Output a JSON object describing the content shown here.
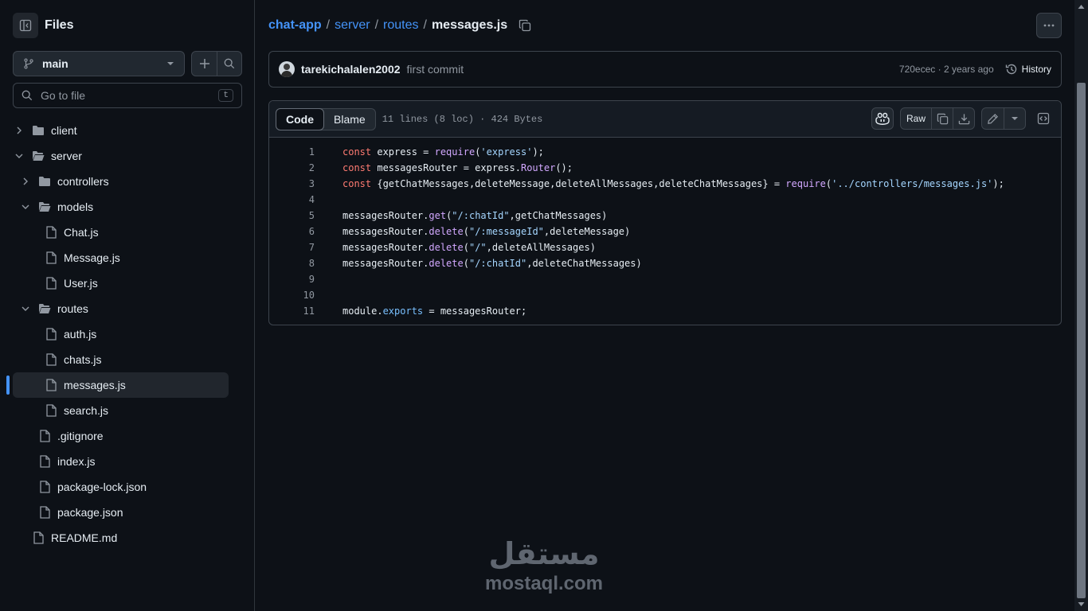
{
  "sidebar": {
    "title": "Files",
    "branch": "main",
    "goto_placeholder": "Go to file",
    "goto_shortcut": "t",
    "tree": [
      {
        "label": "client",
        "type": "folder",
        "state": "collapsed"
      },
      {
        "label": "server",
        "type": "folder",
        "state": "expanded"
      },
      {
        "label": "controllers",
        "type": "folder",
        "state": "collapsed"
      },
      {
        "label": "models",
        "type": "folder",
        "state": "expanded"
      },
      {
        "label": "Chat.js",
        "type": "file"
      },
      {
        "label": "Message.js",
        "type": "file"
      },
      {
        "label": "User.js",
        "type": "file"
      },
      {
        "label": "routes",
        "type": "folder",
        "state": "expanded"
      },
      {
        "label": "auth.js",
        "type": "file"
      },
      {
        "label": "chats.js",
        "type": "file"
      },
      {
        "label": "messages.js",
        "type": "file",
        "selected": true
      },
      {
        "label": "search.js",
        "type": "file"
      },
      {
        "label": ".gitignore",
        "type": "file"
      },
      {
        "label": "index.js",
        "type": "file"
      },
      {
        "label": "package-lock.json",
        "type": "file"
      },
      {
        "label": "package.json",
        "type": "file"
      },
      {
        "label": "README.md",
        "type": "file"
      }
    ]
  },
  "breadcrumb": {
    "parts": [
      "chat-app",
      "server",
      "routes"
    ],
    "separator": "/",
    "current": "messages.js"
  },
  "commit": {
    "author": "tarekichalalen2002",
    "message": "first commit",
    "meta": "720ecec · 2 years ago",
    "history_label": "History"
  },
  "code": {
    "tabs": [
      "Code",
      "Blame"
    ],
    "active_tab": "Code",
    "info": "11 lines (8 loc) · 424 Bytes",
    "raw_label": "Raw",
    "lines": [
      "const express = require('express');",
      "const messagesRouter = express.Router();",
      "const {getChatMessages,deleteMessage,deleteAllMessages,deleteChatMessages} = require('../controllers/messages.js');",
      "",
      "messagesRouter.get(\"/:chatId\",getChatMessages)",
      "messagesRouter.delete(\"/:messageId\",deleteMessage)",
      "messagesRouter.delete(\"/\",deleteAllMessages)",
      "messagesRouter.delete(\"/:chatId\",deleteChatMessages)",
      "",
      "",
      "module.exports = messagesRouter;"
    ]
  },
  "watermark": {
    "arabic": "مستقل",
    "latin": "mostaql.com"
  },
  "colors": {
    "accent": "#4493f8",
    "background": "#0d1117",
    "keyword": "#ff7b72",
    "function": "#d2a8ff",
    "string": "#a5d6ff",
    "property": "#79c0ff"
  }
}
